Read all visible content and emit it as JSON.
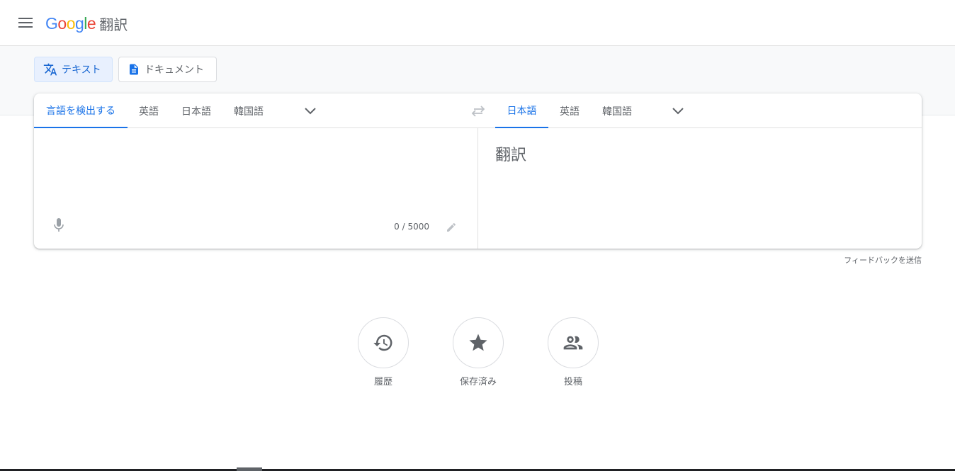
{
  "header": {
    "logo_google": [
      "G",
      "o",
      "o",
      "g",
      "l",
      "e"
    ],
    "logo_colors": [
      "#4285F4",
      "#EA4335",
      "#FBBC05",
      "#4285F4",
      "#34A853",
      "#EA4335"
    ],
    "product_name": "翻訳"
  },
  "modes": {
    "text_label": "テキスト",
    "document_label": "ドキュメント"
  },
  "source": {
    "tabs": [
      "言語を検出する",
      "英語",
      "日本語",
      "韓国語"
    ],
    "active_tab": 0,
    "input_value": "",
    "char_count": "0 / 5000"
  },
  "target": {
    "tabs": [
      "日本語",
      "英語",
      "韓国語"
    ],
    "active_tab": 0,
    "placeholder": "翻訳"
  },
  "feedback_label": "フィードバックを送信",
  "actions": {
    "history_label": "履歴",
    "saved_label": "保存済み",
    "contribute_label": "投稿"
  },
  "colors": {
    "accent": "#1a73e8",
    "icon": "#5f6368"
  }
}
